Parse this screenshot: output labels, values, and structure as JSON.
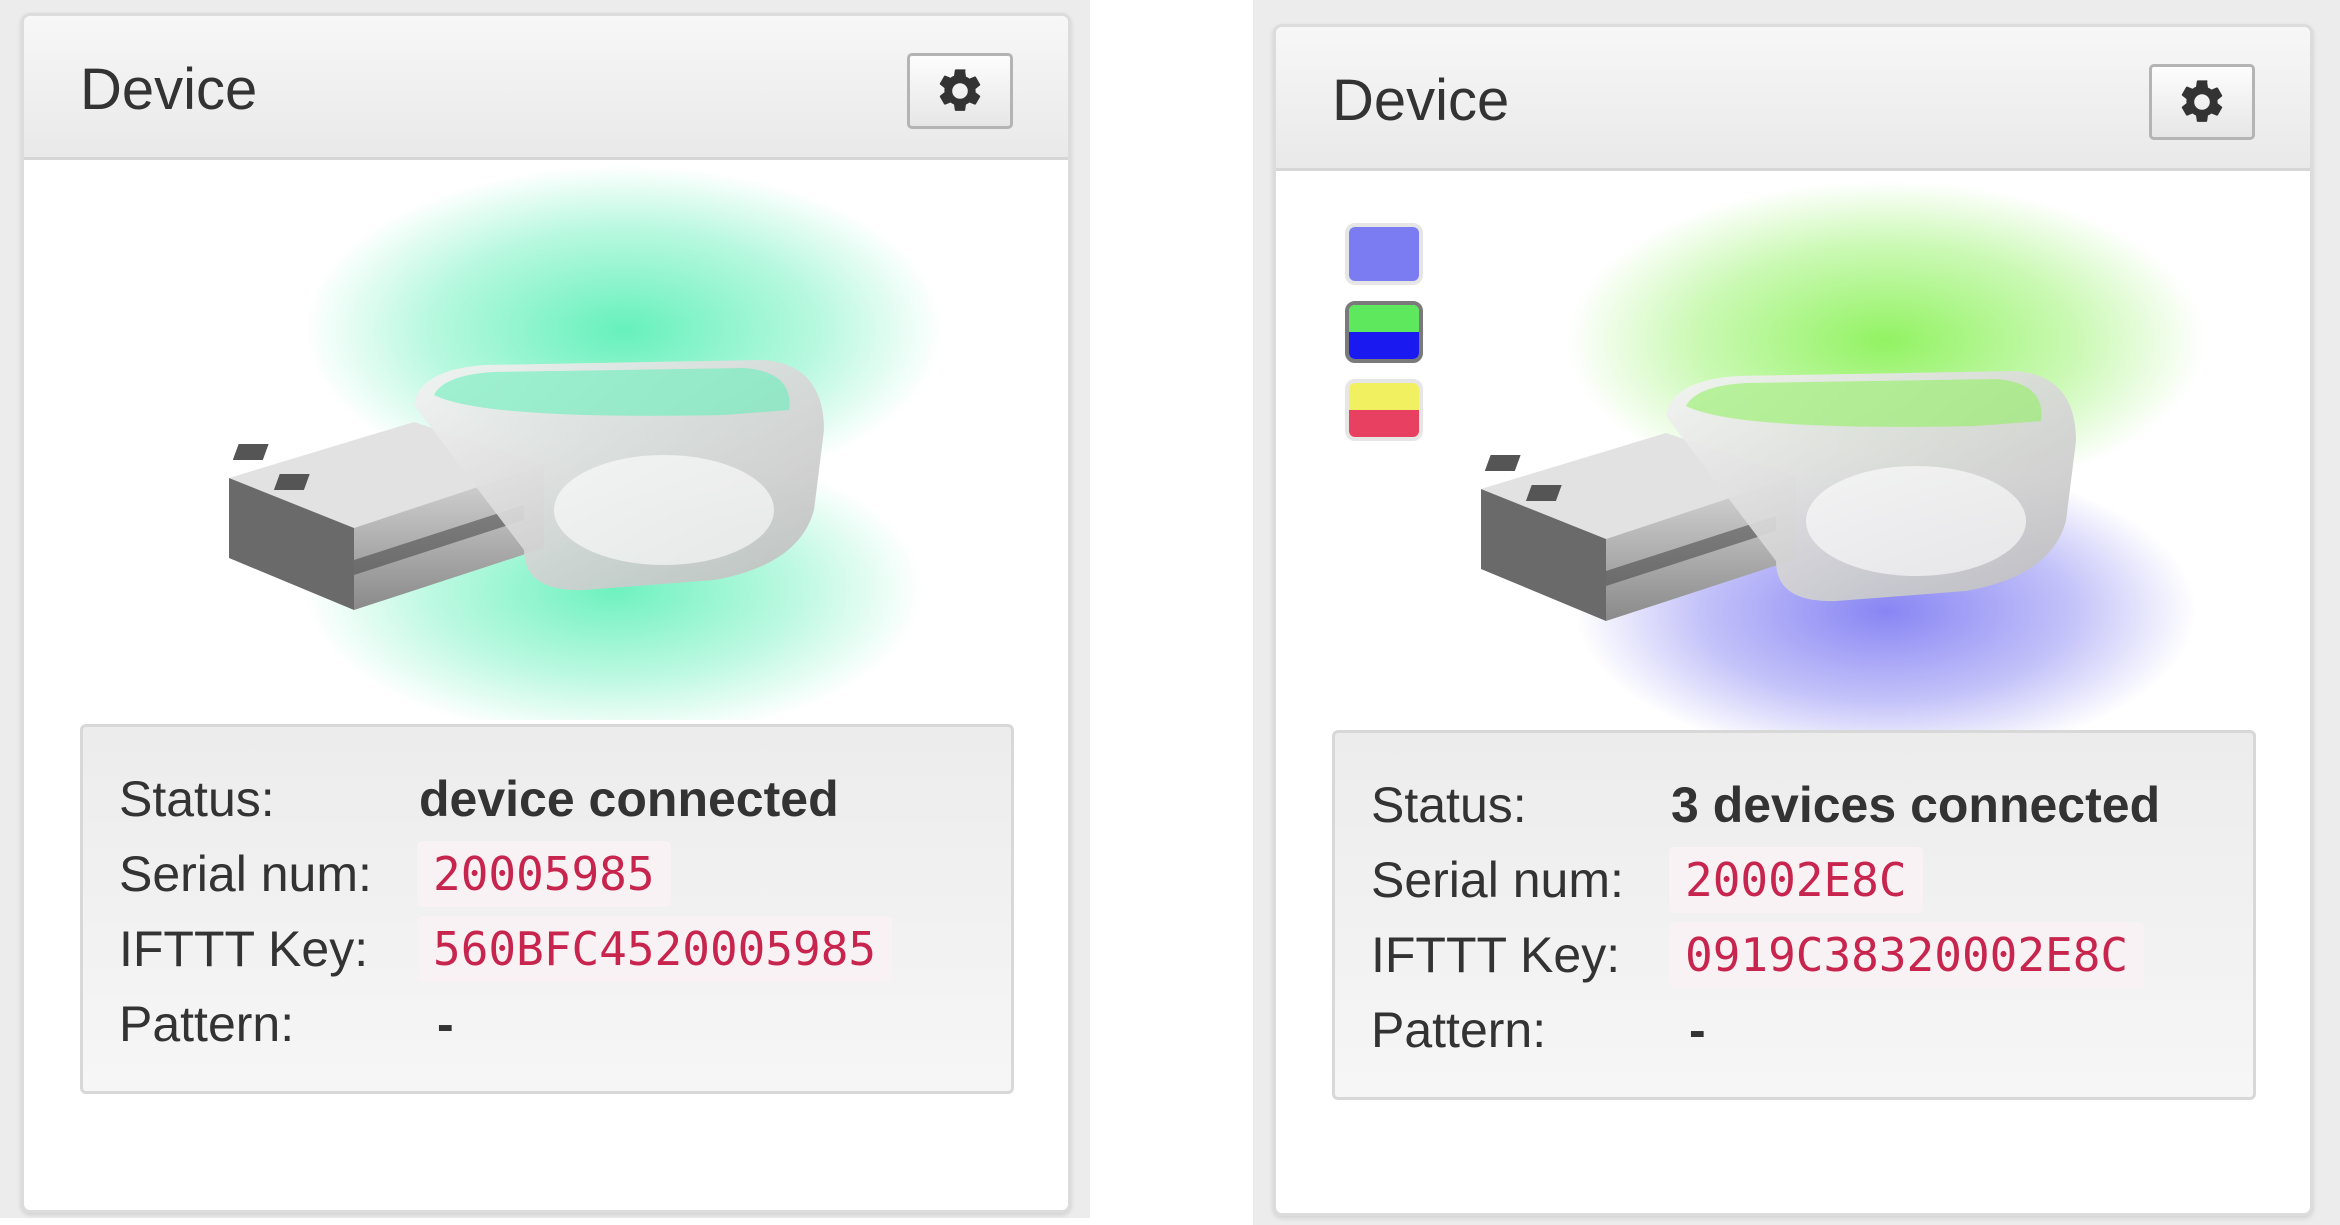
{
  "panels": [
    {
      "title": "Device",
      "settings_icon": "gear-icon",
      "led_glow_colors": [
        "#5ef0b8",
        "#5ef0b8"
      ],
      "status_label": "Status:",
      "status_value": "device connected",
      "serial_label": "Serial num:",
      "serial_value": "20005985",
      "ifttt_label": "IFTTT Key:",
      "ifttt_value": "560BFC4520005985",
      "pattern_label": "Pattern:",
      "pattern_value": "-"
    },
    {
      "title": "Device",
      "settings_icon": "gear-icon",
      "led_glow_colors": [
        "#8cf25a",
        "#7b78f2"
      ],
      "device_swatches": [
        {
          "top": "#7b7cf2",
          "bottom": "#7b7cf2",
          "selected": false
        },
        {
          "top": "#5ee85e",
          "bottom": "#1a1af0",
          "selected": true
        },
        {
          "top": "#f0f060",
          "bottom": "#e84060",
          "selected": false
        }
      ],
      "status_label": "Status:",
      "status_value": "3 devices connected",
      "serial_label": "Serial num:",
      "serial_value": "20002E8C",
      "ifttt_label": "IFTTT Key:",
      "ifttt_value": "0919C38320002E8C",
      "pattern_label": "Pattern:",
      "pattern_value": "-"
    }
  ]
}
